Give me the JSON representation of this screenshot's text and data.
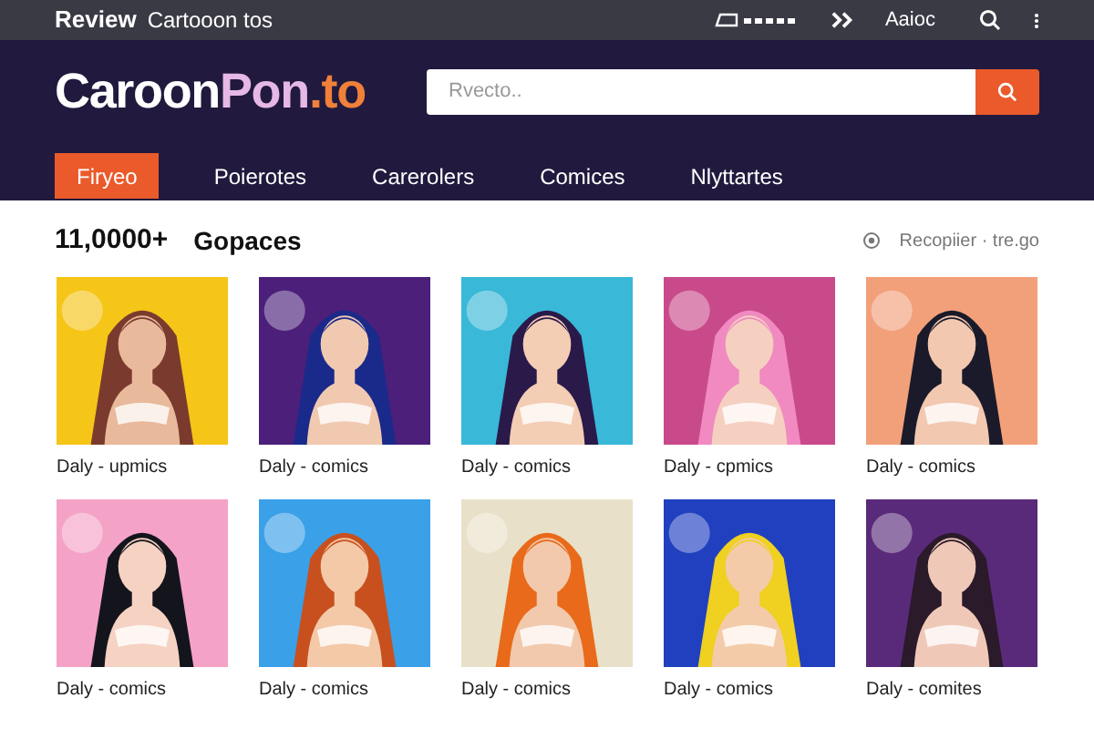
{
  "top_bar": {
    "brand": "Review",
    "title": "Cartooon tos",
    "link": "Aaioc"
  },
  "header": {
    "logo": [
      {
        "text": "Caroon",
        "kind": "white"
      },
      {
        "text": "Pon",
        "kind": "pink"
      },
      {
        "text": ".to",
        "kind": "orange"
      }
    ],
    "search": {
      "placeholder": "Rvecto.."
    }
  },
  "nav": [
    {
      "label": "Firyeo",
      "selected": true
    },
    {
      "label": "Poierotes",
      "selected": false
    },
    {
      "label": "Carerolers",
      "selected": false
    },
    {
      "label": "Comices",
      "selected": false
    },
    {
      "label": "Nlyttartes",
      "selected": false
    }
  ],
  "section": {
    "count": "11,0000+",
    "title": "Gopaces",
    "sort": "Recopiier · tre.go"
  },
  "items": [
    {
      "kind": "picture",
      "caption": "Daly - upmics"
    },
    {
      "kind": "picture",
      "caption": "Daly - comics"
    },
    {
      "kind": "picture",
      "caption": "Daly - comics"
    },
    {
      "kind": "picture",
      "caption": "Daly - cpmics"
    },
    {
      "kind": "picture",
      "caption": "Daly - comics"
    },
    {
      "kind": "picture",
      "caption": "Daly - comics"
    },
    {
      "kind": "picture",
      "caption": "Daly - comics"
    },
    {
      "kind": "picture",
      "caption": "Daly - comics"
    },
    {
      "kind": "picture",
      "caption": "Daly - comics"
    },
    {
      "kind": "picture",
      "caption": "Daly - comites"
    }
  ]
}
